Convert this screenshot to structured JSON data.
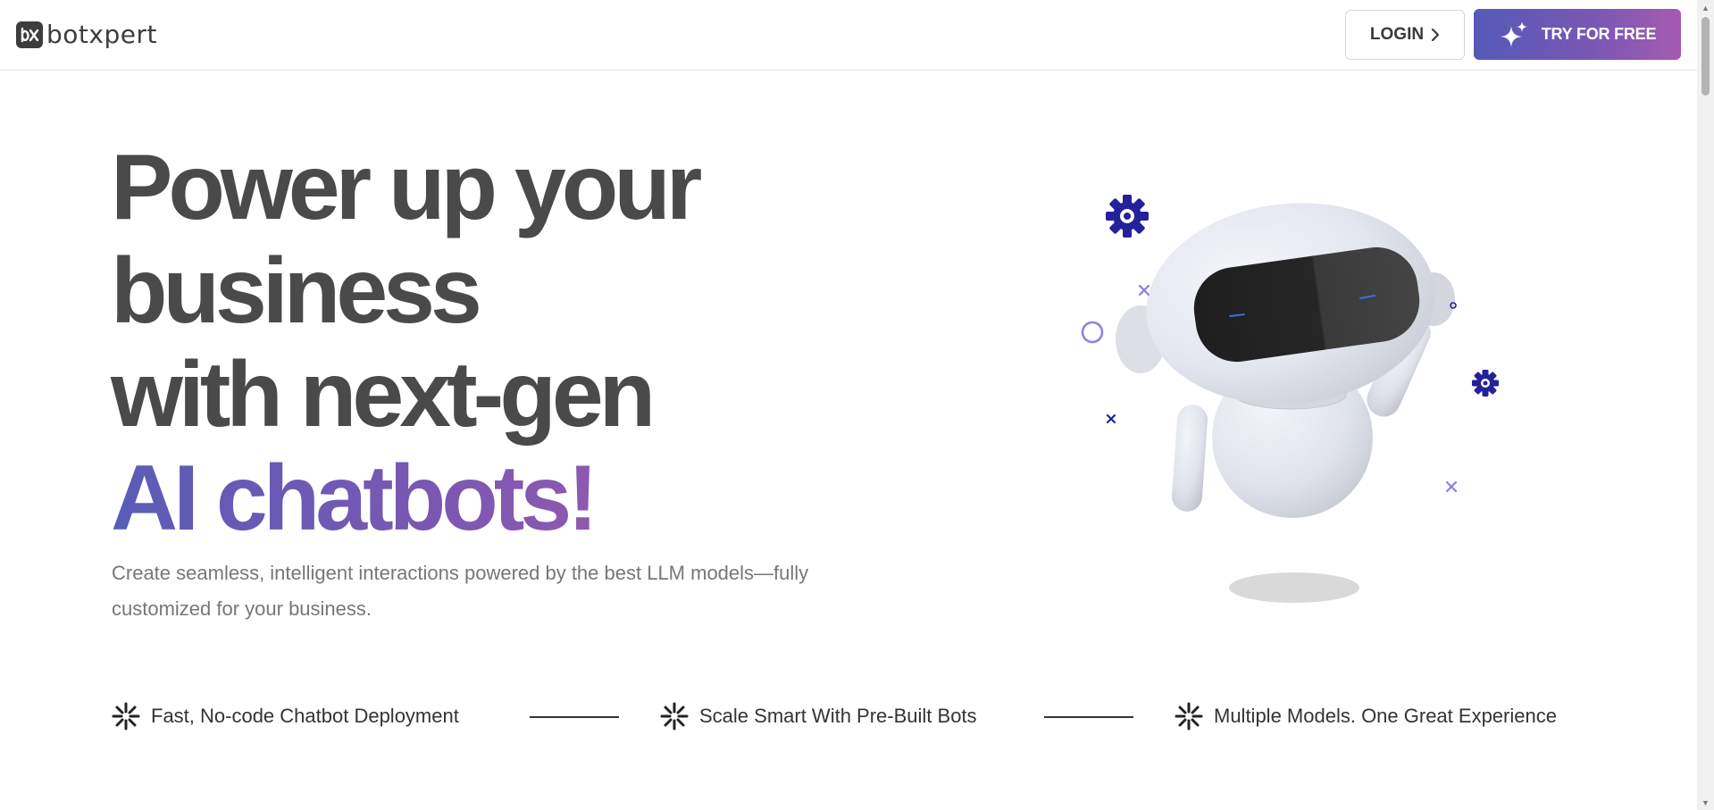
{
  "header": {
    "logo_text": "botxpert",
    "login_label": "LOGIN",
    "try_label": "TRY FOR FREE"
  },
  "hero": {
    "title_line1": "Power up your",
    "title_line2": "business",
    "title_line3": "with next-gen",
    "title_accent": "AI chatbots!",
    "subtitle": "Create seamless, intelligent interactions powered by the best LLM models—fully customized for your business."
  },
  "features": [
    {
      "label": "Fast, No-code Chatbot Deployment",
      "icon": "sparkle-icon"
    },
    {
      "label": "Scale Smart With Pre-Built Bots",
      "icon": "sparkle-icon"
    },
    {
      "label": "Multiple Models. One Great Experience",
      "icon": "sparkle-icon"
    }
  ],
  "colors": {
    "brand_gradient_start": "#5559b8",
    "brand_gradient_end": "#a65ab0",
    "text_dark": "#4a4a4a",
    "gear_blue": "#23229a"
  }
}
